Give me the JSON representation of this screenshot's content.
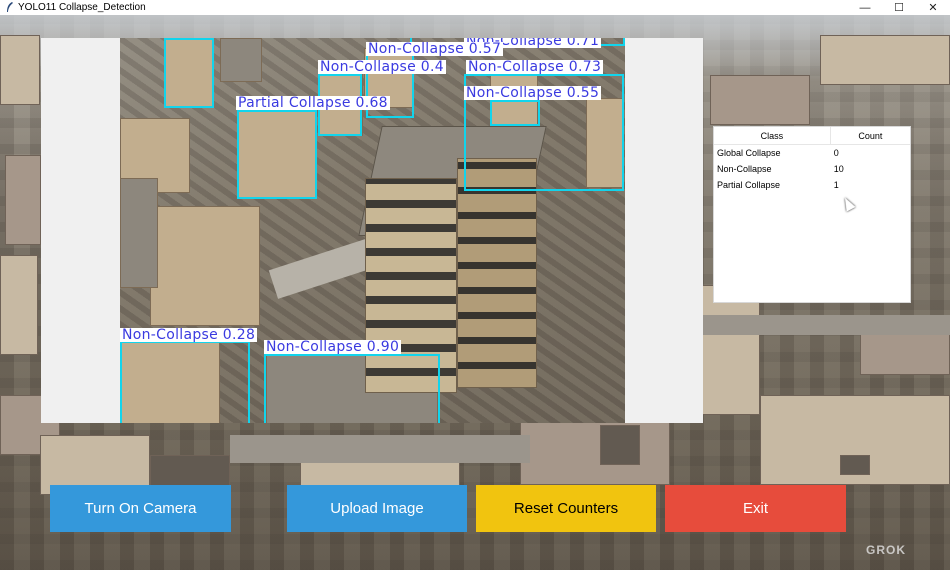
{
  "window": {
    "title": "YOLO11 Collapse_Detection",
    "controls": {
      "minimize": "—",
      "maximize": "☐",
      "close": "✕"
    }
  },
  "detections": [
    {
      "label": "Non-Collapse 0.71"
    },
    {
      "label": "Non-Collapse 0.57"
    },
    {
      "label": "Non-Collapse 0.4"
    },
    {
      "label": "Non-Collapse 0.73"
    },
    {
      "label": "Non-Collapse 0.55"
    },
    {
      "label": "Partial Collapse 0.68"
    },
    {
      "label": "Non-Collapse 0.28"
    },
    {
      "label": "Non-Collapse 0.90"
    }
  ],
  "counts_table": {
    "headers": {
      "class": "Class",
      "count": "Count"
    },
    "rows": [
      {
        "class": "Global Collapse",
        "count": "0"
      },
      {
        "class": "Non-Collapse",
        "count": "10"
      },
      {
        "class": "Partial Collapse",
        "count": "1"
      }
    ]
  },
  "buttons": {
    "camera": "Turn On Camera",
    "upload": "Upload Image",
    "reset": "Reset Counters",
    "exit": "Exit"
  },
  "colors": {
    "box": "#12d4ec",
    "label_text": "#3a3ae0",
    "camera_button": "#3498db",
    "upload_button": "#3498db",
    "reset_button": "#f1c40f",
    "exit_button": "#e74c3c"
  },
  "watermark": "GROK"
}
